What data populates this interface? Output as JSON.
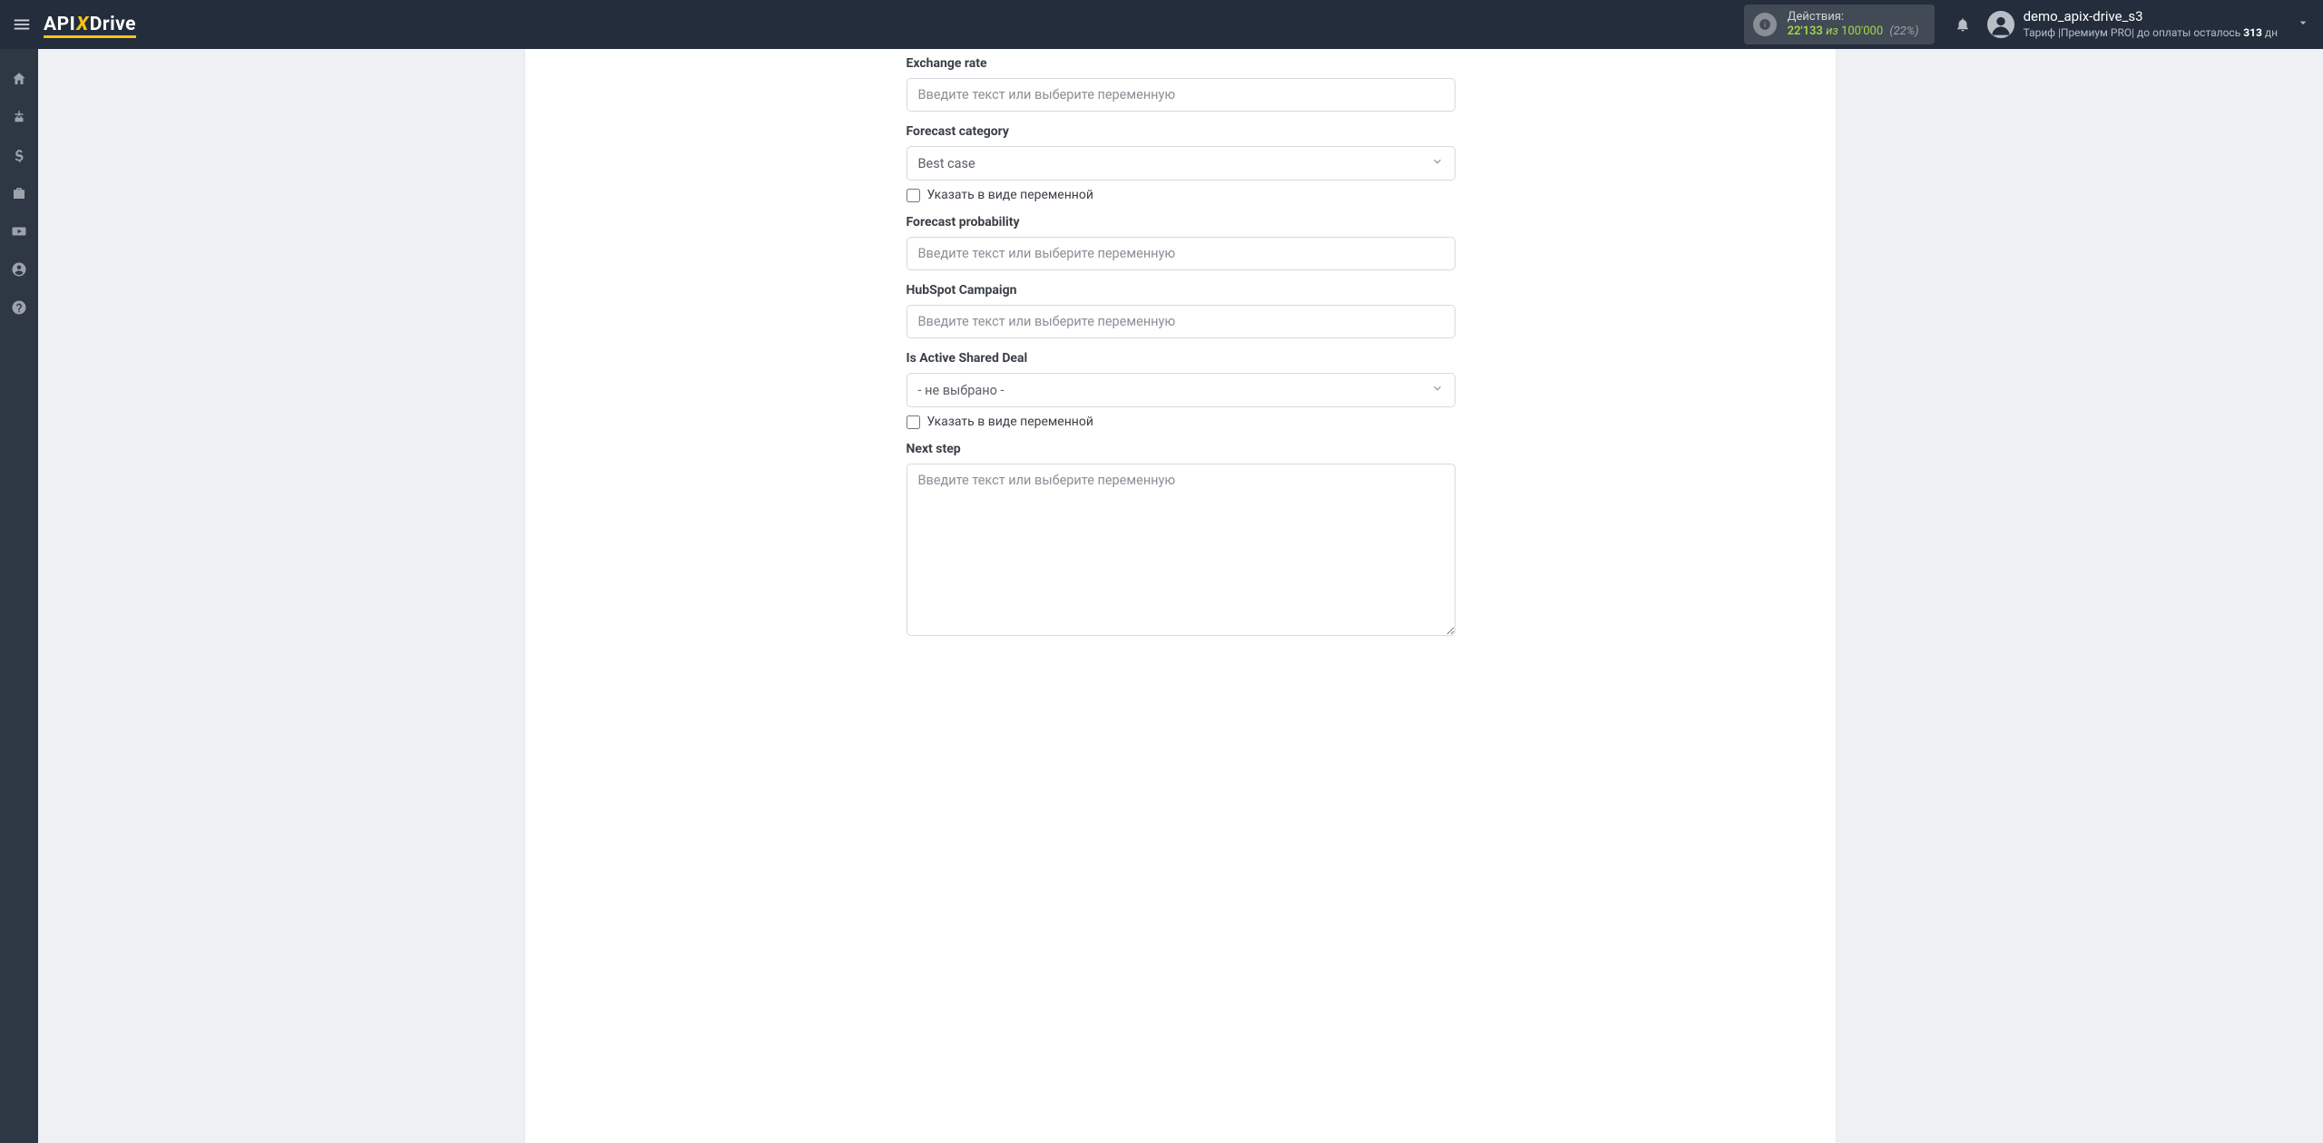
{
  "header": {
    "logo_api": "API",
    "logo_x": "X",
    "logo_drive": "Drive",
    "actions": {
      "label": "Действия:",
      "current": "22'133",
      "of": "из",
      "total": "100'000",
      "pct": "(22%)"
    },
    "user": {
      "name": "demo_apix-drive_s3",
      "tariff_prefix": "Тариф |Премиум PRO| до оплаты осталось ",
      "days": "313",
      "tariff_suffix": " дн"
    }
  },
  "form": {
    "placeholder_text": "Введите текст или выберите переменную",
    "checkbox_label": "Указать в виде переменной",
    "not_selected": "- не выбрано -",
    "fields": {
      "exchange_rate": {
        "label": "Exchange rate"
      },
      "forecast_category": {
        "label": "Forecast category",
        "value": "Best case"
      },
      "forecast_probability": {
        "label": "Forecast probability"
      },
      "hubspot_campaign": {
        "label": "HubSpot Campaign"
      },
      "is_active_shared_deal": {
        "label": "Is Active Shared Deal"
      },
      "next_step": {
        "label": "Next step"
      }
    }
  }
}
